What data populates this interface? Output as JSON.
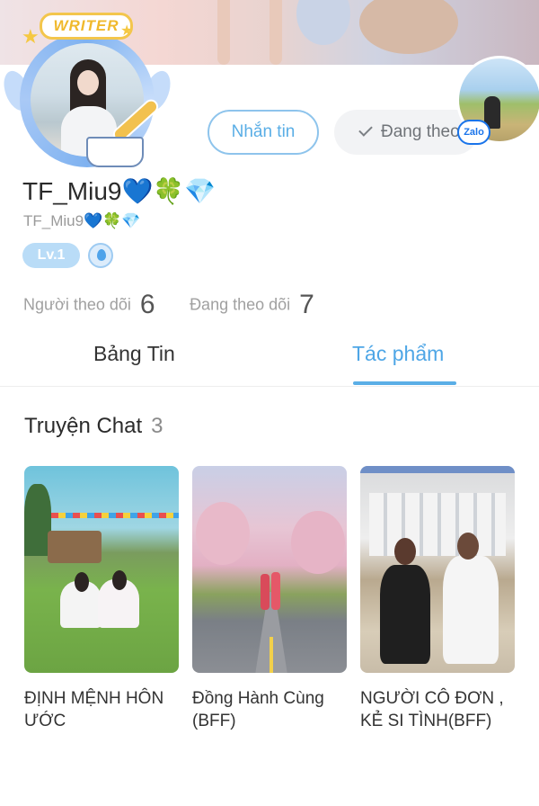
{
  "profile": {
    "badge_text": "WRITER",
    "name": "TF_Miu9💙🍀💎",
    "username": "TF_Miu9💙🍀💎",
    "level": "Lv.1"
  },
  "actions": {
    "message_label": "Nhắn tin",
    "following_label": "Đang theo dõi",
    "zalo_label": "Zalo"
  },
  "stats": {
    "followers_label": "Người theo dõi",
    "followers_value": "6",
    "following_label": "Đang theo dõi",
    "following_value": "7"
  },
  "tabs": [
    {
      "label": "Bảng Tin",
      "active": false
    },
    {
      "label": "Tác phẩm",
      "active": true
    }
  ],
  "section": {
    "title": "Truyện Chat",
    "count": "3"
  },
  "stories": [
    {
      "title": "ĐỊNH MỆNH HÔN ƯỚC"
    },
    {
      "title": "Đồng Hành Cùng (BFF)"
    },
    {
      "title": "NGƯỜI CÔ ĐƠN , KẺ SI TÌNH(BFF)"
    }
  ],
  "colors": {
    "accent": "#5aaee6",
    "level_badge": "#b9dcf7",
    "zalo_blue": "#1a74ea"
  }
}
